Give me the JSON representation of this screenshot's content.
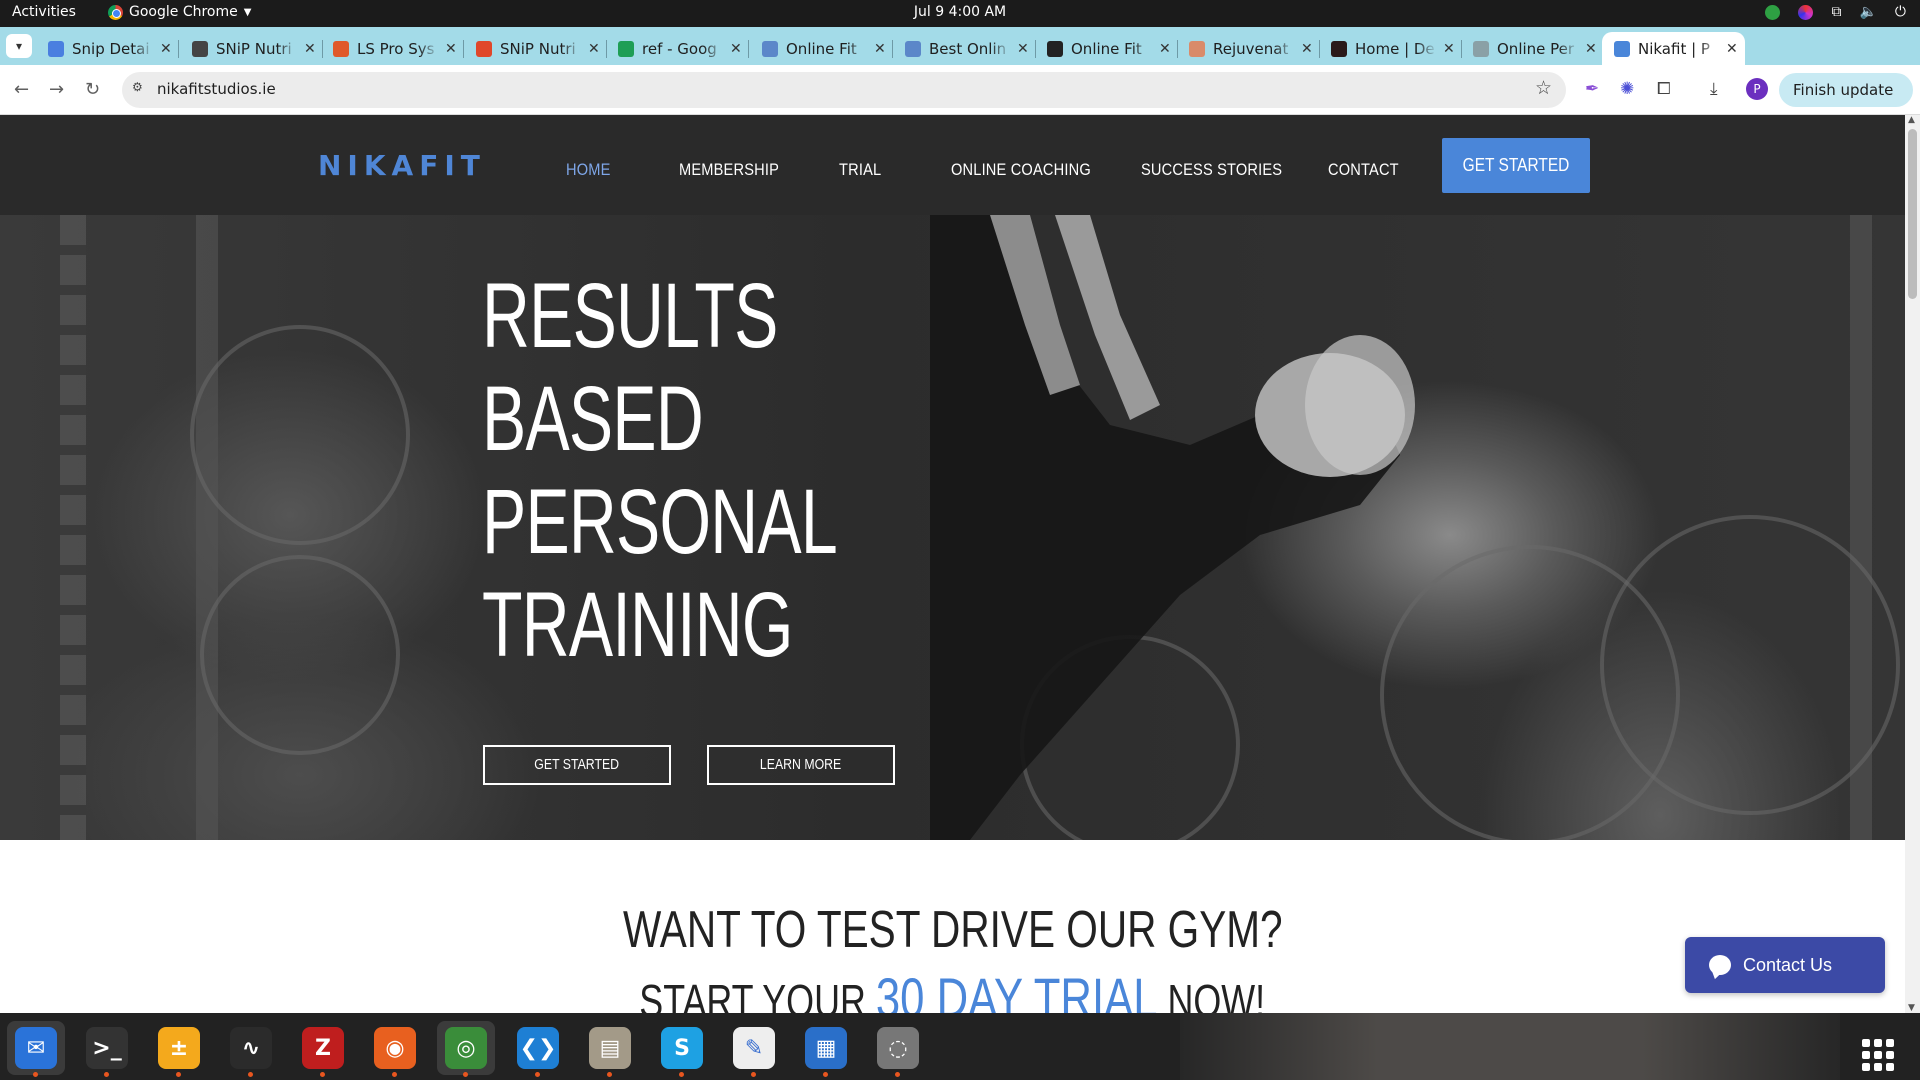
{
  "system_bar": {
    "activities": "Activities",
    "app_name": "Google Chrome",
    "clock": "Jul 9  4:00 AM"
  },
  "tabs": [
    {
      "title": "Snip Detai",
      "favicon_color": "#4a7fe0"
    },
    {
      "title": "SNiP Nutri",
      "favicon_color": "#444444"
    },
    {
      "title": "LS Pro Sys",
      "favicon_color": "#e0592a"
    },
    {
      "title": "SNiP Nutri",
      "favicon_color": "#e0472a"
    },
    {
      "title": "ref - Goog",
      "favicon_color": "#1e9e55"
    },
    {
      "title": "Online Fit",
      "favicon_color": "#5b87c9"
    },
    {
      "title": "Best Onlin",
      "favicon_color": "#5b87c9"
    },
    {
      "title": "Online Fit",
      "favicon_color": "#222222"
    },
    {
      "title": "Rejuvenat",
      "favicon_color": "#d98b6a"
    },
    {
      "title": "Home | De",
      "favicon_color": "#2a1a1a"
    },
    {
      "title": "Online Per",
      "favicon_color": "#8aa0a6"
    },
    {
      "title": "Nikafit | P",
      "favicon_color": "#4a86d9"
    }
  ],
  "active_tab_index": 11,
  "toolbar": {
    "url": "nikafitstudios.ie",
    "profile_initial": "P",
    "finish_update": "Finish update"
  },
  "site": {
    "logo": "NIKAFIT",
    "nav": [
      "HOME",
      "MEMBERSHIP",
      "TRIAL",
      "ONLINE COACHING",
      "SUCCESS STORIES",
      "CONTACT"
    ],
    "active_nav": "HOME",
    "cta": "GET STARTED",
    "hero": {
      "lines": [
        "RESULTS",
        "BASED",
        "PERSONAL",
        "TRAINING"
      ],
      "btn_primary": "GET STARTED",
      "btn_secondary": "LEARN MORE"
    },
    "trial": {
      "heading": "WANT TO TEST DRIVE OUR GYM?",
      "sub_prefix": "START YOUR",
      "sub_accent": "30 DAY TRIAL",
      "sub_suffix": "NOW!"
    },
    "contact_widget": "Contact Us"
  },
  "colors": {
    "brand_blue": "#4a86d9",
    "header_bg": "#2a2a2a",
    "tabstrip_bg": "#a3dbe8"
  },
  "dock": [
    {
      "name": "thunderbird-icon",
      "color": "#2a73d9",
      "glyph": "✉"
    },
    {
      "name": "terminal-icon",
      "color": "#333333",
      "glyph": ">_"
    },
    {
      "name": "calculator-icon",
      "color": "#f4a91c",
      "glyph": "±"
    },
    {
      "name": "system-monitor-icon",
      "color": "#2b2b2b",
      "glyph": "∿"
    },
    {
      "name": "filezilla-icon",
      "color": "#bf1e1e",
      "glyph": "Z"
    },
    {
      "name": "firefox-icon",
      "color": "#e8601f",
      "glyph": "◉"
    },
    {
      "name": "chrome-icon",
      "color": "#3a8d3a",
      "glyph": "◎"
    },
    {
      "name": "vscode-icon",
      "color": "#1e7fd4",
      "glyph": "❮❯"
    },
    {
      "name": "files-icon",
      "color": "#a39a88",
      "glyph": "▤"
    },
    {
      "name": "skype-icon",
      "color": "#1ea1e3",
      "glyph": "S"
    },
    {
      "name": "text-editor-icon",
      "color": "#eeeeee",
      "glyph": "✎"
    },
    {
      "name": "writer-icon",
      "color": "#2a6fc9",
      "glyph": "▦"
    },
    {
      "name": "disk-icon",
      "color": "#777777",
      "glyph": "◌"
    }
  ]
}
